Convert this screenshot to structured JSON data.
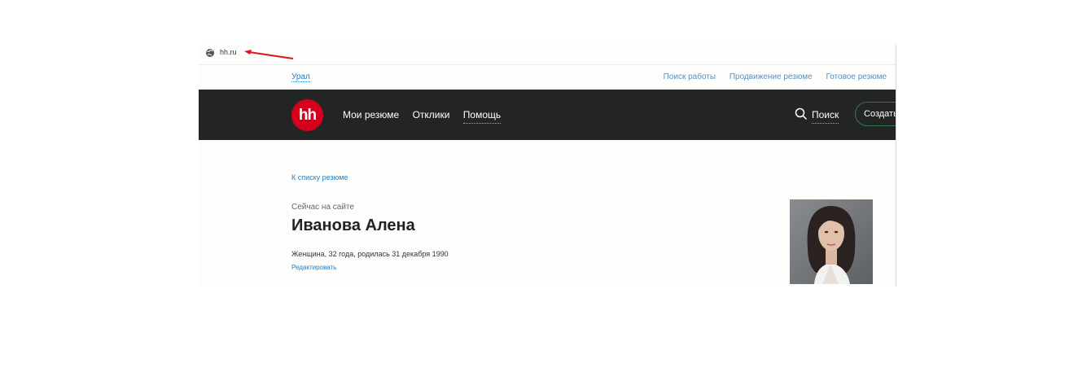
{
  "browser": {
    "url": "hh.ru"
  },
  "topbar": {
    "region": "Урал",
    "links": [
      "Поиск работы",
      "Продвижение резюме",
      "Готовое резюме"
    ]
  },
  "header": {
    "logo": "hh",
    "nav": [
      "Мои резюме",
      "Отклики",
      "Помощь"
    ],
    "search_label": "Поиск",
    "create_label": "Создать"
  },
  "resume": {
    "back_link": "К списку резюме",
    "status": "Сейчас на сайте",
    "name": "Иванова Алена",
    "info": "Женщина, 32 года, родилась 31 декабря 1990",
    "edit_link": "Редактировать"
  },
  "colors": {
    "brand": "#d6001c",
    "header_bg": "#232525",
    "link": "#2b7bb9",
    "annotation_arrow": "#e0151b"
  },
  "icons": {
    "browser": "globe-icon",
    "search": "search-icon",
    "arrow": "red-arrow-annotation"
  }
}
